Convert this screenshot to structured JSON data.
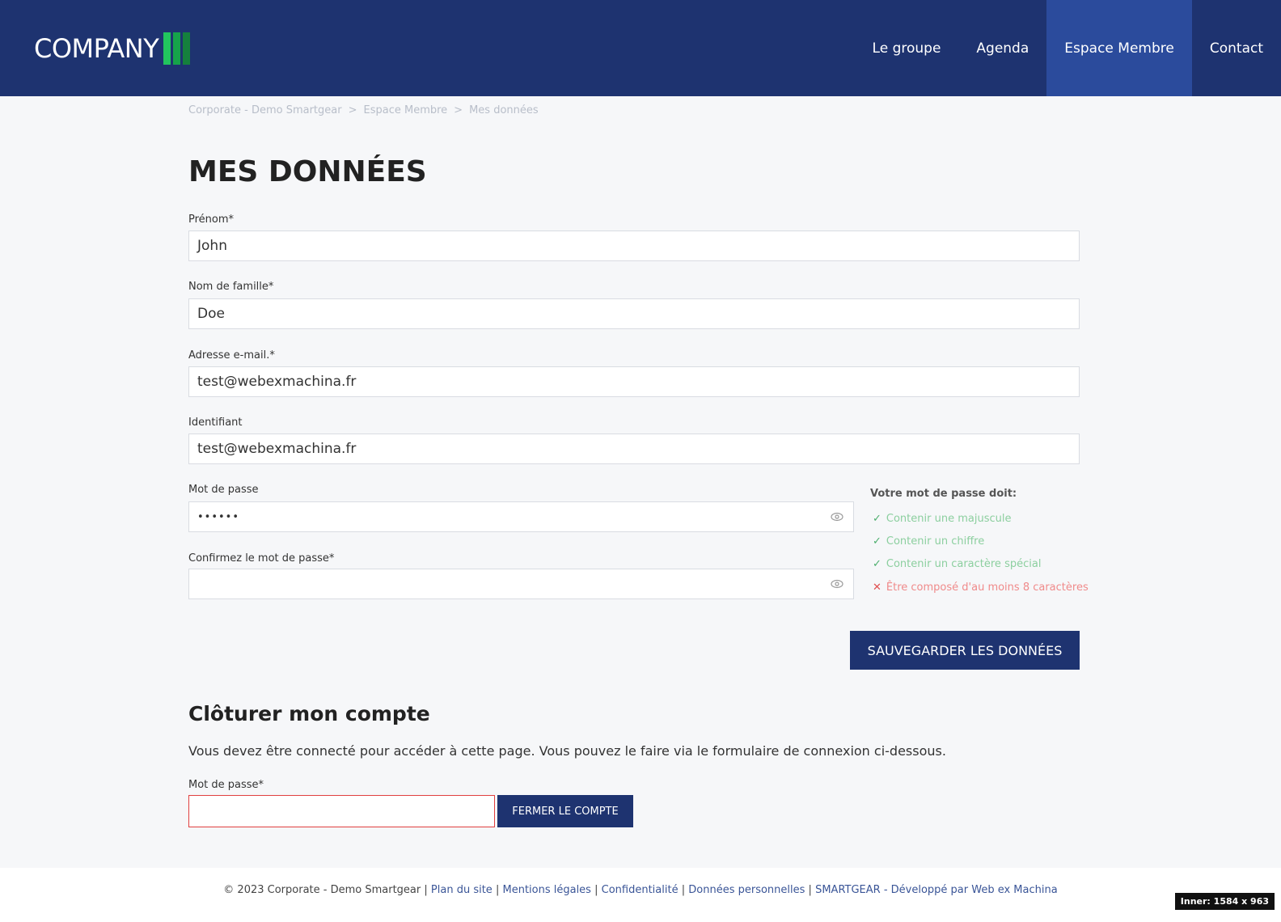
{
  "header": {
    "logo_text": "COMPANY",
    "nav": [
      "Le groupe",
      "Agenda",
      "Espace Membre",
      "Contact"
    ]
  },
  "breadcrumb": [
    "Corporate - Demo Smartgear",
    "Espace Membre",
    "Mes données"
  ],
  "breadcrumb_sep": ">",
  "page_title": "MES DONNÉES",
  "form": {
    "first_name": {
      "label": "Prénom*",
      "value": "John"
    },
    "last_name": {
      "label": "Nom de famille*",
      "value": "Doe"
    },
    "email": {
      "label": "Adresse e-mail.*",
      "value": "test@webexmachina.fr"
    },
    "username": {
      "label": "Identifiant",
      "value": "test@webexmachina.fr"
    },
    "password": {
      "label": "Mot de passe",
      "value": "••••••"
    },
    "confirm_password": {
      "label": "Confirmez le mot de passe*",
      "value": ""
    },
    "save_label": "SAUVEGARDER LES DONNÉES"
  },
  "password_rules": {
    "title": "Votre mot de passe doit:",
    "items": [
      {
        "text": "Contenir une majuscule",
        "ok": true
      },
      {
        "text": "Contenir un chiffre",
        "ok": true
      },
      {
        "text": "Contenir un caractère spécial",
        "ok": true
      },
      {
        "text": "Être composé d'au moins 8 caractères",
        "ok": false
      }
    ]
  },
  "close_account": {
    "title": "Clôturer mon compte",
    "text": "Vous devez être connecté pour accéder à cette page. Vous pouvez le faire via le formulaire de connexion ci-dessous.",
    "password_label": "Mot de passe*",
    "button_label": "FERMER LE COMPTE"
  },
  "footer": {
    "copyright": "© 2023 Corporate - Demo Smartgear",
    "links": [
      "Plan du site",
      "Mentions légales",
      "Confidentialité",
      "Données personnelles",
      "SMARTGEAR - Développé par Web ex Machina"
    ],
    "sep": "|"
  },
  "inner_badge": "Inner: 1584 x 963",
  "colors": {
    "header_bg": "#1e3370",
    "nav_active_bg": "#2b4b9c",
    "logo_green": "#22c55e",
    "rule_ok": "#4caf6d",
    "rule_bad": "#e05050"
  }
}
